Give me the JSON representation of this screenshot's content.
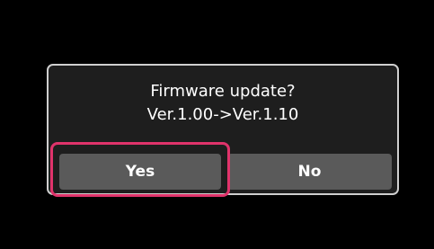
{
  "dialog": {
    "message_line1": "Firmware update?",
    "message_line2": "Ver.1.00->Ver.1.10",
    "yes_label": "Yes",
    "no_label": "No"
  },
  "colors": {
    "screen_background": "#000000",
    "dialog_background": "#1e1e1e",
    "dialog_border": "#cfcfcf",
    "button_background": "#5a5a5a",
    "text": "#ffffff",
    "highlight": "#e0336b"
  },
  "highlighted_button": "Yes"
}
